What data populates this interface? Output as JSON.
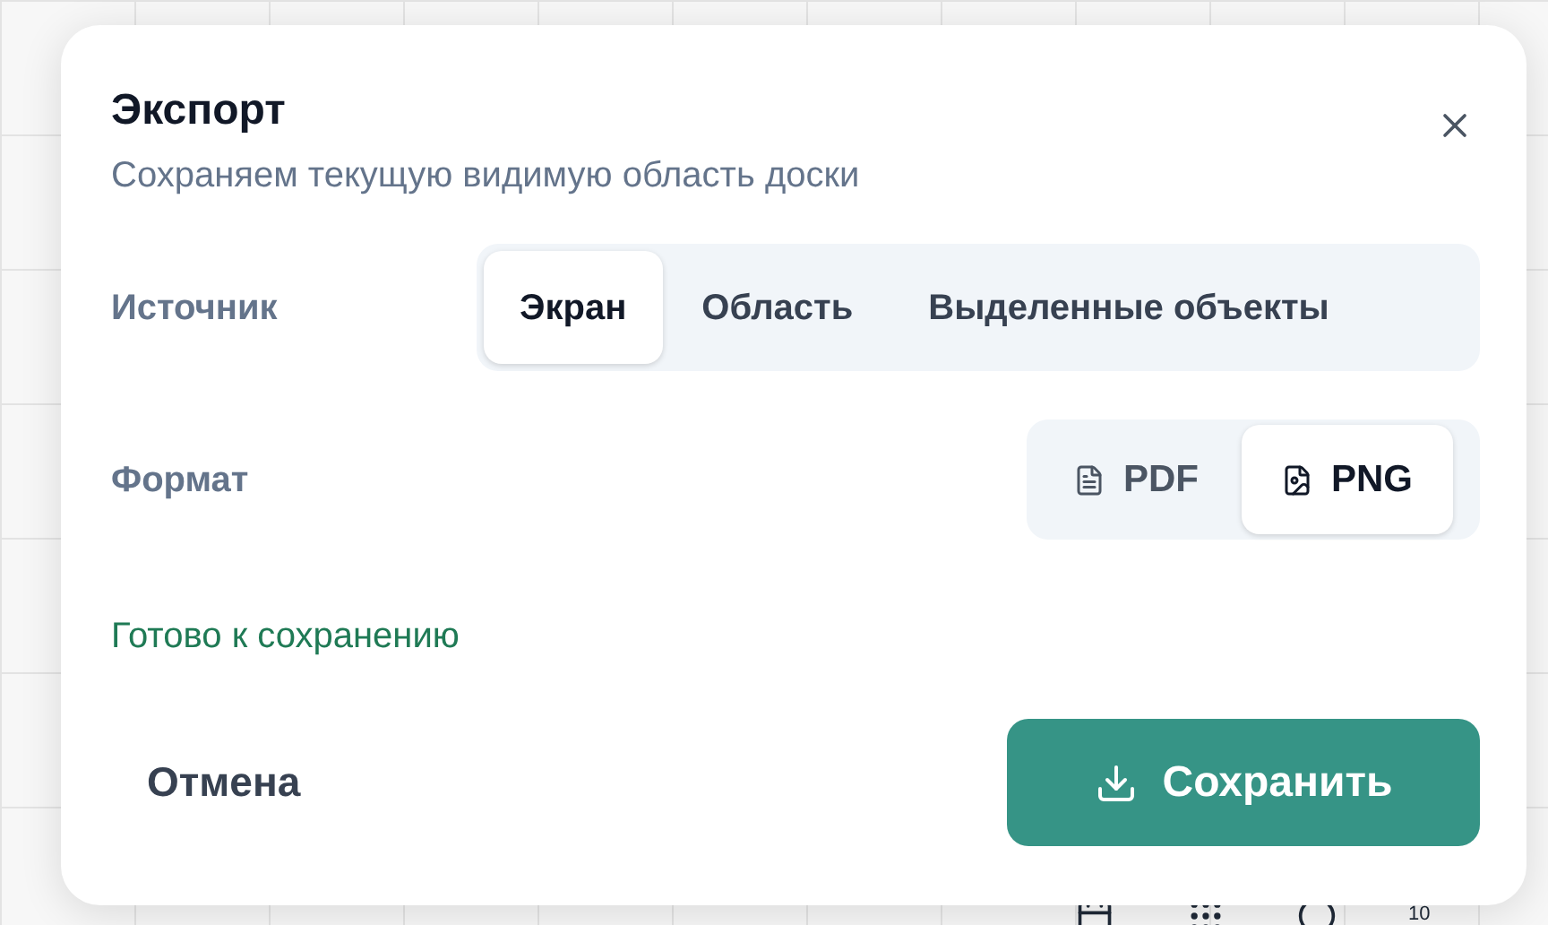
{
  "dialog": {
    "title": "Экспорт",
    "subtitle": "Сохраняем текущую видимую область доски",
    "source": {
      "label": "Источник",
      "options": [
        {
          "label": "Экран",
          "selected": true
        },
        {
          "label": "Область",
          "selected": false
        },
        {
          "label": "Выделенные объекты",
          "selected": false
        }
      ]
    },
    "format": {
      "label": "Формат",
      "options": [
        {
          "label": "PDF",
          "kind": "document",
          "selected": false
        },
        {
          "label": "PNG",
          "kind": "image",
          "selected": true
        }
      ]
    },
    "status": "Готово к сохранению",
    "buttons": {
      "cancel": "Отмена",
      "save": "Сохранить"
    }
  },
  "toolbar": {
    "zoom": "10"
  }
}
